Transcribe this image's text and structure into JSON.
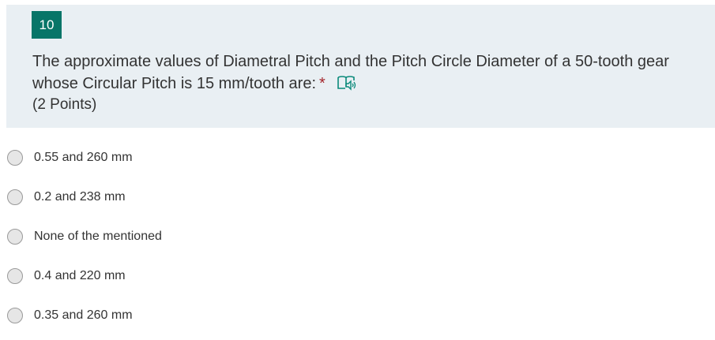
{
  "question": {
    "number": "10",
    "text": "The approximate values of Diametral Pitch and the Pitch Circle Diameter of a 50-tooth gear whose Circular Pitch is 15 mm/tooth are:",
    "required_marker": "*",
    "points": "(2 Points)",
    "reader_icon": "immersive-reader-icon"
  },
  "options": [
    {
      "label": "0.55 and 260 mm",
      "selected": false
    },
    {
      "label": "0.2 and 238 mm",
      "selected": false
    },
    {
      "label": "None of the mentioned",
      "selected": false
    },
    {
      "label": "0.4 and 220 mm",
      "selected": false
    },
    {
      "label": "0.35 and 260 mm",
      "selected": false
    }
  ],
  "colors": {
    "accent": "#077568",
    "card_background": "#e9eff3",
    "required": "#a4262c",
    "text": "#333333"
  }
}
